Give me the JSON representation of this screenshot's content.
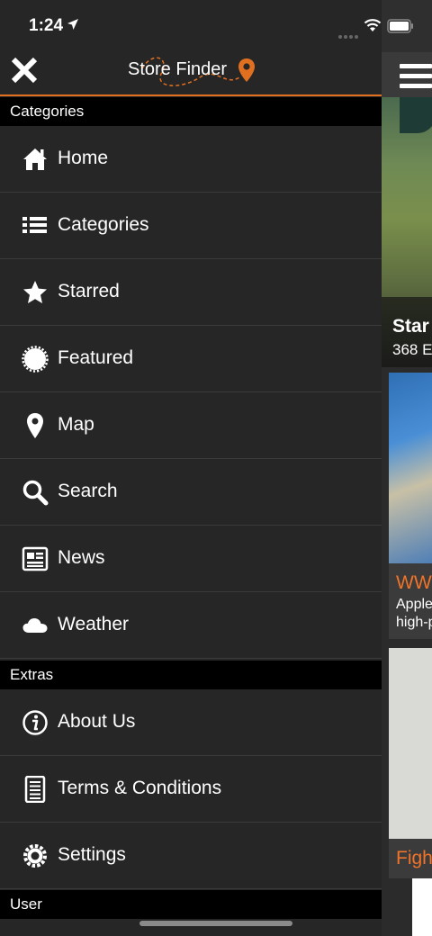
{
  "status_bar": {
    "time": "1:24"
  },
  "header": {
    "logo_text": "Store Finder",
    "accent_color": "#e07020"
  },
  "sections": {
    "categories": "Categories",
    "extras": "Extras",
    "user": "User"
  },
  "menu": {
    "home": "Home",
    "categories": "Categories",
    "starred": "Starred",
    "featured": "Featured",
    "map": "Map",
    "search": "Search",
    "news": "News",
    "weather": "Weather",
    "about": "About Us",
    "terms": "Terms & Conditions",
    "settings": "Settings"
  },
  "background": {
    "hero_title": "Star",
    "hero_subtitle": "368 E",
    "card1_title": "WW",
    "card1_line1": "Apple",
    "card1_line2": "high-p",
    "card2_title": "Fight"
  }
}
